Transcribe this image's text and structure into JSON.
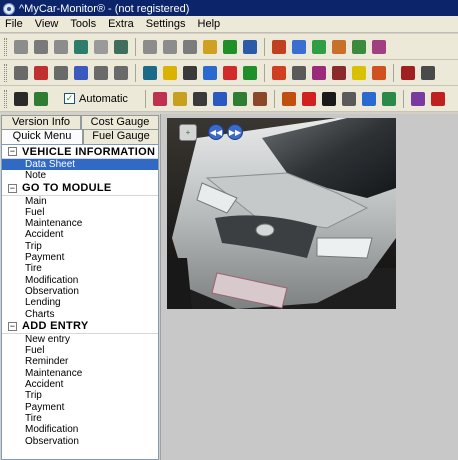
{
  "window": {
    "title": "^MyCar-Monitor® - (not registered)"
  },
  "menubar": {
    "items": [
      "File",
      "View",
      "Tools",
      "Extra",
      "Settings",
      "Help"
    ]
  },
  "toolbar_rows": [
    {
      "icons": [
        {
          "name": "close-file-icon",
          "color": "#8c8c8c"
        },
        {
          "name": "refresh-icon",
          "color": "#7a7a7a"
        },
        {
          "name": "forward-icon",
          "color": "#8c8c8c"
        },
        {
          "name": "export-icon",
          "color": "#2e7d6b"
        },
        {
          "name": "stop-icon",
          "color": "#9a9a9a"
        },
        {
          "name": "megaphone-icon",
          "color": "#3f6e5c"
        },
        {
          "name": "tag-icon",
          "color": "#8c8c8c"
        },
        {
          "name": "warning-icon",
          "color": "#8c8c8c"
        },
        {
          "name": "gear-icon",
          "color": "#7c7c7c"
        },
        {
          "name": "sun-icon",
          "color": "#d0a020"
        },
        {
          "name": "dollar-icon",
          "color": "#1f8f2a"
        },
        {
          "name": "network-icon",
          "color": "#2a5aa8"
        },
        {
          "name": "calendar-icon",
          "color": "#c04020"
        },
        {
          "name": "document-icon",
          "color": "#3a6ed0"
        },
        {
          "name": "ruler-icon",
          "color": "#2f9e44"
        },
        {
          "name": "house-icon",
          "color": "#c8702a"
        },
        {
          "name": "chart-icon",
          "color": "#3c8a3c"
        },
        {
          "name": "graph-icon",
          "color": "#a04080"
        }
      ]
    },
    {
      "icons": [
        {
          "name": "grid-icon",
          "color": "#6a6a6a"
        },
        {
          "name": "bottles-icon",
          "color": "#c03030"
        },
        {
          "name": "table-icon",
          "color": "#6a6a6a"
        },
        {
          "name": "bar-chart-icon",
          "color": "#3a5ac0"
        },
        {
          "name": "calculator-icon",
          "color": "#6a6a6a"
        },
        {
          "name": "window-icon",
          "color": "#6a6a6a"
        },
        {
          "name": "wallet-icon",
          "color": "#1a6a8a"
        },
        {
          "name": "speedometer-icon",
          "color": "#d9b300"
        },
        {
          "name": "list-icon",
          "color": "#3a3a3a"
        },
        {
          "name": "mechanic-icon",
          "color": "#2a6ad0"
        },
        {
          "name": "car-icon",
          "color": "#d02a2a"
        },
        {
          "name": "money-icon",
          "color": "#1f8f2a"
        },
        {
          "name": "fuel-icon",
          "color": "#d04020"
        },
        {
          "name": "help-icon",
          "color": "#5a5a5a"
        },
        {
          "name": "shopping-icon",
          "color": "#9a2a7a"
        },
        {
          "name": "book-icon",
          "color": "#8a2a2a"
        },
        {
          "name": "bulb-icon",
          "color": "#d9c000"
        },
        {
          "name": "lens-icon",
          "color": "#d05020"
        },
        {
          "name": "crossing-icon",
          "color": "#a02020"
        },
        {
          "name": "settings-icon",
          "color": "#4a4a4a"
        }
      ]
    },
    {
      "icons": [
        {
          "name": "traffic-light-icon",
          "color": "#2a2a2a"
        },
        {
          "name": "car-check-icon",
          "color": "#2e7d32"
        }
      ],
      "checkbox_label": "Automatic",
      "icons_after": [
        {
          "name": "eraser-icon",
          "color": "#c03050"
        },
        {
          "name": "pie-icon",
          "color": "#c8a020"
        },
        {
          "name": "sum-icon",
          "color": "#3a3a3a"
        },
        {
          "name": "garage-icon",
          "color": "#2a5ac0"
        },
        {
          "name": "gas-pump-icon",
          "color": "#2e7d32"
        },
        {
          "name": "wrench-icon",
          "color": "#8a4a2a"
        },
        {
          "name": "trailer-icon",
          "color": "#c05010"
        },
        {
          "name": "accident-icon",
          "color": "#d02020"
        },
        {
          "name": "tire-icon",
          "color": "#1a1a1a"
        },
        {
          "name": "dollar-badge-icon",
          "color": "#5a5a5a"
        },
        {
          "name": "eye-icon",
          "color": "#2a6ad0"
        },
        {
          "name": "signpost-icon",
          "color": "#2a8a4a"
        },
        {
          "name": "chart-line-icon",
          "color": "#7a3aa0"
        },
        {
          "name": "location-icon",
          "color": "#c02020"
        }
      ]
    }
  ],
  "tabs": {
    "row1": [
      "Version Info",
      "Cost Gauge"
    ],
    "row2": [
      "Quick Menu",
      "Fuel Gauge"
    ],
    "active": "Quick Menu"
  },
  "sections": [
    {
      "title": "VEHICLE INFORMATION",
      "items": [
        "Data Sheet",
        "Note"
      ],
      "selected": "Data Sheet"
    },
    {
      "title": "GO TO MODULE",
      "items": [
        "Main",
        "Fuel",
        "Maintenance",
        "Accident",
        "Trip",
        "Payment",
        "Tire",
        "Modification",
        "Observation",
        "Lending",
        "Charts"
      ]
    },
    {
      "title": "ADD ENTRY",
      "items": [
        "New entry",
        "Fuel",
        "Reminder",
        "Maintenance",
        "Accident",
        "Trip",
        "Payment",
        "Tire",
        "Modification",
        "Observation"
      ]
    }
  ],
  "viewer": {
    "buttons": [
      {
        "name": "add-photo-icon",
        "glyph": "+"
      },
      {
        "name": "previous-icon",
        "glyph": "◀◀"
      },
      {
        "name": "next-icon",
        "glyph": "▶▶"
      }
    ]
  }
}
